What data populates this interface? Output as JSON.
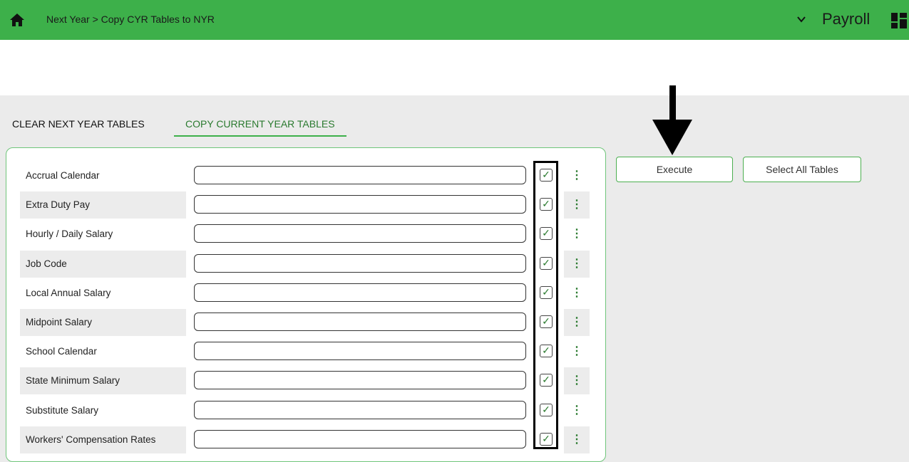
{
  "header": {
    "breadcrumb": "Next Year > Copy CYR Tables to NYR",
    "app_name": "Payroll",
    "background": "#3db04a"
  },
  "tabs": [
    {
      "label": "CLEAR NEXT YEAR TABLES",
      "active": false
    },
    {
      "label": "COPY CURRENT YEAR TABLES",
      "active": true
    }
  ],
  "buttons": {
    "execute": "Execute",
    "select_all": "Select All Tables"
  },
  "tables": [
    {
      "label": "Accrual Calendar",
      "value": "",
      "checked": true,
      "check": "✓",
      "more": "⋮"
    },
    {
      "label": "Extra Duty Pay",
      "value": "",
      "checked": true,
      "check": "✓",
      "more": "⋮"
    },
    {
      "label": "Hourly / Daily Salary",
      "value": "",
      "checked": true,
      "check": "✓",
      "more": "⋮"
    },
    {
      "label": "Job Code",
      "value": "",
      "checked": true,
      "check": "✓",
      "more": "⋮"
    },
    {
      "label": "Local Annual Salary",
      "value": "",
      "checked": true,
      "check": "✓",
      "more": "⋮"
    },
    {
      "label": "Midpoint Salary",
      "value": "",
      "checked": true,
      "check": "✓",
      "more": "⋮"
    },
    {
      "label": "School Calendar",
      "value": "",
      "checked": true,
      "check": "✓",
      "more": "⋮"
    },
    {
      "label": "State Minimum Salary",
      "value": "",
      "checked": true,
      "check": "✓",
      "more": "⋮"
    },
    {
      "label": "Substitute Salary",
      "value": "",
      "checked": true,
      "check": "✓",
      "more": "⋮"
    },
    {
      "label": "Workers' Compensation Rates",
      "value": "",
      "checked": true,
      "check": "✓",
      "more": "⋮"
    }
  ],
  "colors": {
    "accent": "#3db04a",
    "panel_border": "#6fc57a"
  }
}
